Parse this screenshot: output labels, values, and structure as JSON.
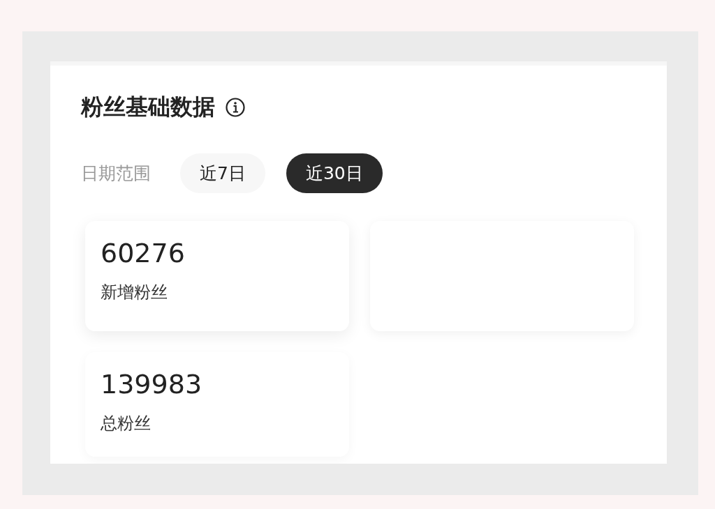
{
  "title": "粉丝基础数据",
  "date_range": {
    "label": "日期范围",
    "options": [
      {
        "label": "近7日",
        "selected": false
      },
      {
        "label": "近30日",
        "selected": true
      }
    ]
  },
  "stats": [
    {
      "value": "60276",
      "label": "新增粉丝"
    },
    {
      "kind": "empty"
    },
    {
      "value": "139983",
      "label": "总粉丝"
    }
  ]
}
